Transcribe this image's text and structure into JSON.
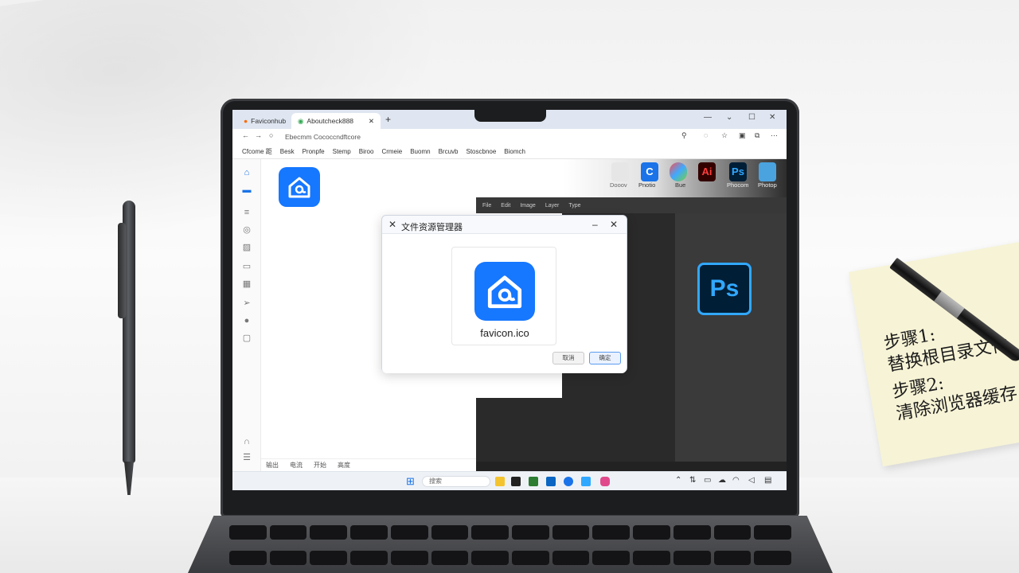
{
  "browser": {
    "tabs": [
      {
        "label": "Faviconhub"
      },
      {
        "label": "Aboutcheck888"
      }
    ],
    "new_tab": "+",
    "window_controls": {
      "min": "—",
      "max": "☐",
      "close": "✕"
    },
    "address": "Ebecmm Cococcndftcore",
    "bookmarks": [
      "Cfcome 距",
      "Besk",
      "Pronpfe",
      "Stemp",
      "Biroo",
      "Crmeie",
      "Buomn",
      "Brcuvb",
      "Stoscbnoe",
      "Biomch"
    ]
  },
  "page": {
    "status_items": [
      "输出",
      "电流",
      "开始",
      "高度"
    ]
  },
  "apps": [
    {
      "name": "Dooov",
      "color": "#d0d0d0",
      "glyph": ""
    },
    {
      "name": "Pnotio",
      "color": "#1a73e8",
      "glyph": "C"
    },
    {
      "name": "Bue",
      "color": "#ff7a45",
      "glyph": ""
    },
    {
      "name": "",
      "color": "#330000",
      "glyph": "Ai"
    },
    {
      "name": "Phocom",
      "color": "#001e36",
      "glyph": "Ps"
    },
    {
      "name": "Photop",
      "color": "#4aa3df",
      "glyph": ""
    }
  ],
  "photoshop": {
    "menu": [
      "File",
      "Edit",
      "Image",
      "Layer",
      "Type"
    ],
    "logo": "Ps"
  },
  "dialog": {
    "title": "文件资源管理器",
    "file_name": "favicon.ico",
    "buttons": {
      "secondary": "取消",
      "primary": "确定"
    }
  },
  "taskbar": {
    "search_placeholder": "搜索"
  },
  "sticky_note": {
    "lines": [
      "步骤1:",
      "替换根目录文件",
      "步骤2:",
      "清除浏览器缓存"
    ]
  }
}
